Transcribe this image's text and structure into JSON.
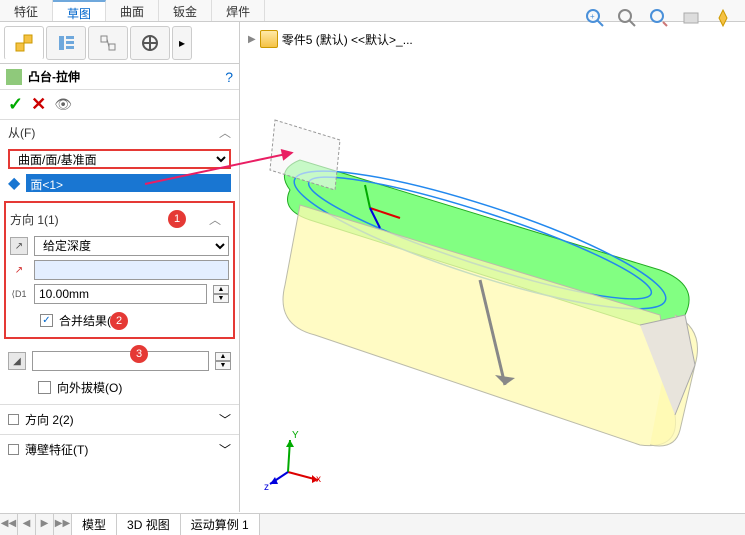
{
  "ribbon": {
    "tabs": [
      "特征",
      "草图",
      "曲面",
      "钣金",
      "焊件"
    ],
    "activeIndex": 1
  },
  "breadcrumb": {
    "part": "零件5 (默认) <<默认>_..."
  },
  "leftPanel": {
    "featureTitle": "凸台-拉伸",
    "from": {
      "header": "从(F)",
      "dropdown": "曲面/面/基准面",
      "selection": "面<1>"
    },
    "direction1": {
      "header": "方向 1(1)",
      "endCond": "给定深度",
      "depth": "10.00mm",
      "merge": "合并结果(M)",
      "draft": "向外拔模(O)"
    },
    "direction2": "方向 2(2)",
    "thinFeature": "薄壁特征(T)"
  },
  "bottomTabs": [
    "模型",
    "3D 视图",
    "运动算例 1"
  ],
  "callouts": {
    "c1": "1",
    "c2": "2",
    "c3": "3"
  },
  "triad": {
    "x": "x",
    "y": "Y",
    "z": "z"
  },
  "icons": {
    "check": "✓",
    "cross": "✕",
    "eye": "👁",
    "help": "?",
    "blueArrow": "◆",
    "caret_up": "︿",
    "caret_dn": "﹀",
    "sp_up": "▲",
    "sp_dn": "▼",
    "nav": [
      "◀◀",
      "◀",
      "▶",
      "▶▶"
    ]
  }
}
